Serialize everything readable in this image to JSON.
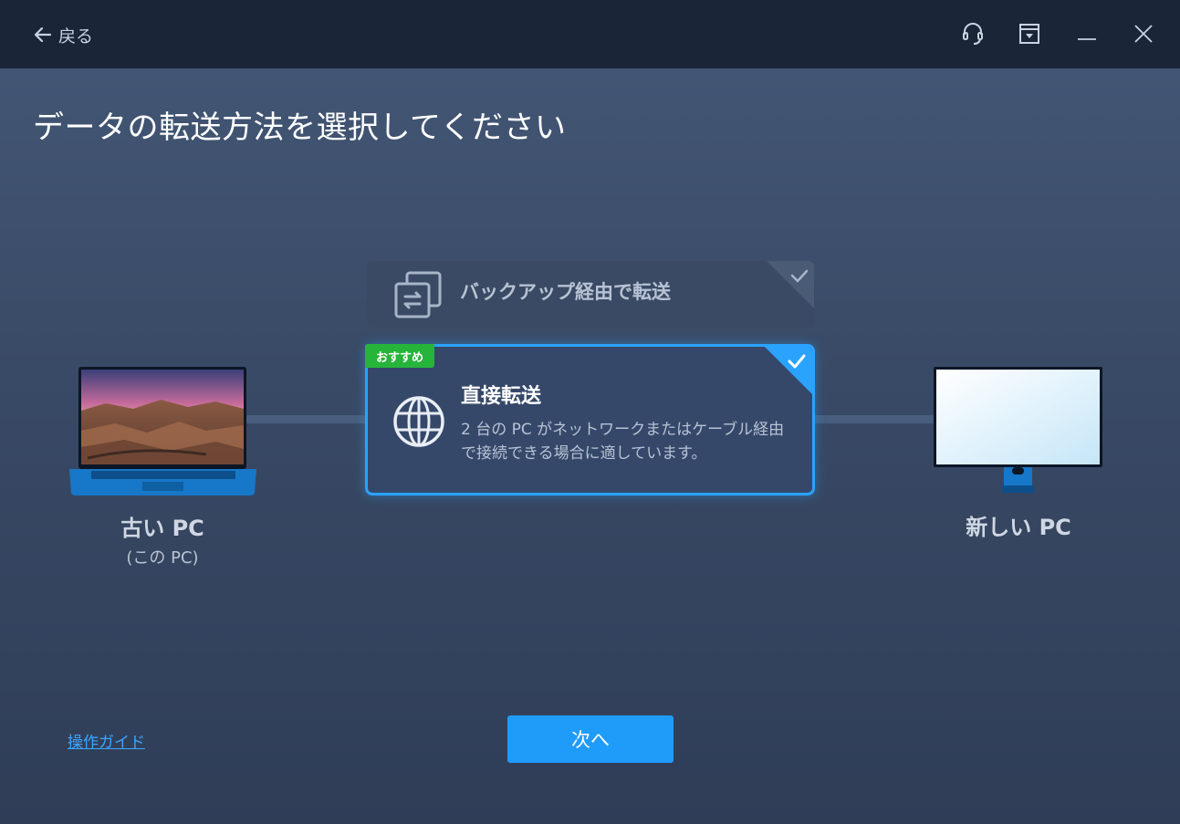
{
  "titlebar": {
    "back_label": "戻る",
    "icons": [
      "arrow-left-icon",
      "headset-icon",
      "dropdown-box-icon",
      "minimize-icon",
      "close-icon"
    ]
  },
  "page": {
    "title": "データの転送方法を選択してください"
  },
  "options": {
    "backup": {
      "title": "バックアップ経由で転送",
      "icon": "backup-transfer-icon",
      "selected": false
    },
    "direct": {
      "title": "直接転送",
      "description": "2 台の PC がネットワークまたはケーブル経由で接続できる場合に適しています。",
      "badge": "おすすめ",
      "icon": "globe-icon",
      "selected": true
    }
  },
  "devices": {
    "old": {
      "label": "古い PC",
      "sublabel": "(この PC)"
    },
    "new": {
      "label": "新しい PC"
    }
  },
  "footer": {
    "guide_link": "操作ガイド",
    "next_label": "次へ"
  },
  "colors": {
    "accent": "#1f9bfa",
    "badge_green": "#27b43a",
    "titlebar": "#1b2538",
    "background": "#3b4c69"
  }
}
